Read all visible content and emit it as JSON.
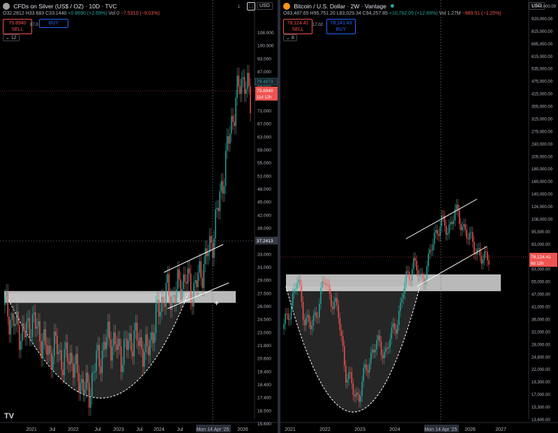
{
  "left": {
    "title": "CFDs on Silver (US$ / OZ) · 10D · TVC",
    "ohlc": {
      "o": "O32.2812",
      "h": "H33.683",
      "l": "",
      "c": "C33.1440",
      "chg": "+0.8690 (+2.69%)",
      "vol": "Vol 0",
      "vol_chg": "−7.5310 (−9.03%)"
    },
    "sell": {
      "price": "75.8940",
      "label": "SELL"
    },
    "spread": "87.0",
    "buy": {
      "price": "",
      "label": "BUY"
    },
    "interval_badge": "12",
    "currency": "USD",
    "last_price": "75.8940",
    "countdown": "11d 12h",
    "crosshair_price": "37.2413",
    "prev_label": "79.4973",
    "time_label": "Mon 14 Apr '25",
    "logo": "TV"
  },
  "right": {
    "title": "Bitcoin / U.S. Dollar · 2W · Vantage",
    "ohlc": {
      "o": "O83,487.65",
      "h": "H95,751.20",
      "l": "L83,029.34",
      "c": "C94,257.85",
      "chg": "+10,762.05 (+12.89%)",
      "vol": "Vol 1.27M",
      "vol_chg": "−989.51 (−1.25%)"
    },
    "sell": {
      "price": "78,124.41",
      "label": "SELL"
    },
    "spread": "17.02",
    "buy": {
      "price": "78,141.43",
      "label": "BUY"
    },
    "interval_badge": "8",
    "currency": "USD",
    "last_price": "78,124.41",
    "countdown": "8d 12h",
    "time_label": "Mon 14 Apr '25"
  },
  "colors": {
    "up": "#26a69a",
    "down": "#ef5350",
    "bg": "#000000",
    "zone": "#d9d9d9",
    "line": "#ffffff"
  },
  "chart_data": [
    {
      "type": "candlestick",
      "title": "CFDs on Silver (US$ / OZ) · 10D · TVC",
      "y_ticks": [
        "108.000",
        "100.000",
        "93.000",
        "87.000",
        "81.000",
        "75.000",
        "71.000",
        "67.000",
        "63.000",
        "59.000",
        "55.000",
        "51.000",
        "48.000",
        "45.000",
        "42.000",
        "39.000",
        "35.000",
        "33.000",
        "31.000",
        "29.000",
        "27.500",
        "26.000",
        "24.500",
        "23.000",
        "21.800",
        "20.600",
        "19.400",
        "18.400",
        "17.400",
        "16.500",
        "15.600"
      ],
      "x_ticks": [
        "2021",
        "Jul",
        "2022",
        "Jul",
        "2023",
        "Jul",
        "2024",
        "Jul",
        "Mon 14 Apr '25",
        "2026"
      ],
      "support_zone": [
        28.3,
        30.0
      ],
      "close_approx": [
        28,
        26,
        25,
        24,
        26,
        25,
        23,
        22,
        23,
        21,
        22,
        20,
        19,
        18,
        21,
        22,
        24,
        23,
        22,
        23,
        24,
        23,
        22,
        25,
        28,
        30,
        29,
        31,
        32,
        30,
        32,
        35,
        38,
        45,
        55,
        68,
        80,
        87,
        76
      ]
    },
    {
      "type": "candlestick",
      "title": "Bitcoin / U.S. Dollar · 2W · Vantage",
      "y_ticks": [
        "1,040,000.00",
        "920,000.00",
        "815,000.00",
        "695,000.00",
        "615,000.00",
        "535,000.00",
        "475,000.00",
        "415,000.00",
        "355,000.00",
        "315,000.00",
        "275,000.00",
        "240,000.00",
        "205,000.00",
        "180,000.00",
        "160,000.00",
        "140,000.00",
        "124,000.00",
        "108,000.00",
        "95,500.00",
        "83,000.00",
        "72,500.00",
        "63,000.00",
        "55,000.00",
        "47,000.00",
        "41,000.00",
        "36,000.00",
        "32,000.00",
        "28,000.00",
        "24,800.00",
        "22,000.00",
        "19,300.00",
        "17,000.00",
        "15,300.00",
        "13,600.00"
      ],
      "x_ticks": [
        "2021",
        "2022",
        "2023",
        "2024",
        "Mon 14 Apr '25",
        "2026",
        "2027"
      ],
      "support_zone": [
        52000,
        62000
      ],
      "close_approx": [
        35000,
        45000,
        58000,
        40000,
        35000,
        45000,
        58000,
        48000,
        40000,
        22000,
        19000,
        17000,
        23000,
        28000,
        30000,
        27000,
        35000,
        42000,
        62000,
        68000,
        60000,
        65000,
        95000,
        105000,
        100000,
        118000,
        108000,
        90000,
        85000,
        70000,
        78000
      ]
    }
  ]
}
